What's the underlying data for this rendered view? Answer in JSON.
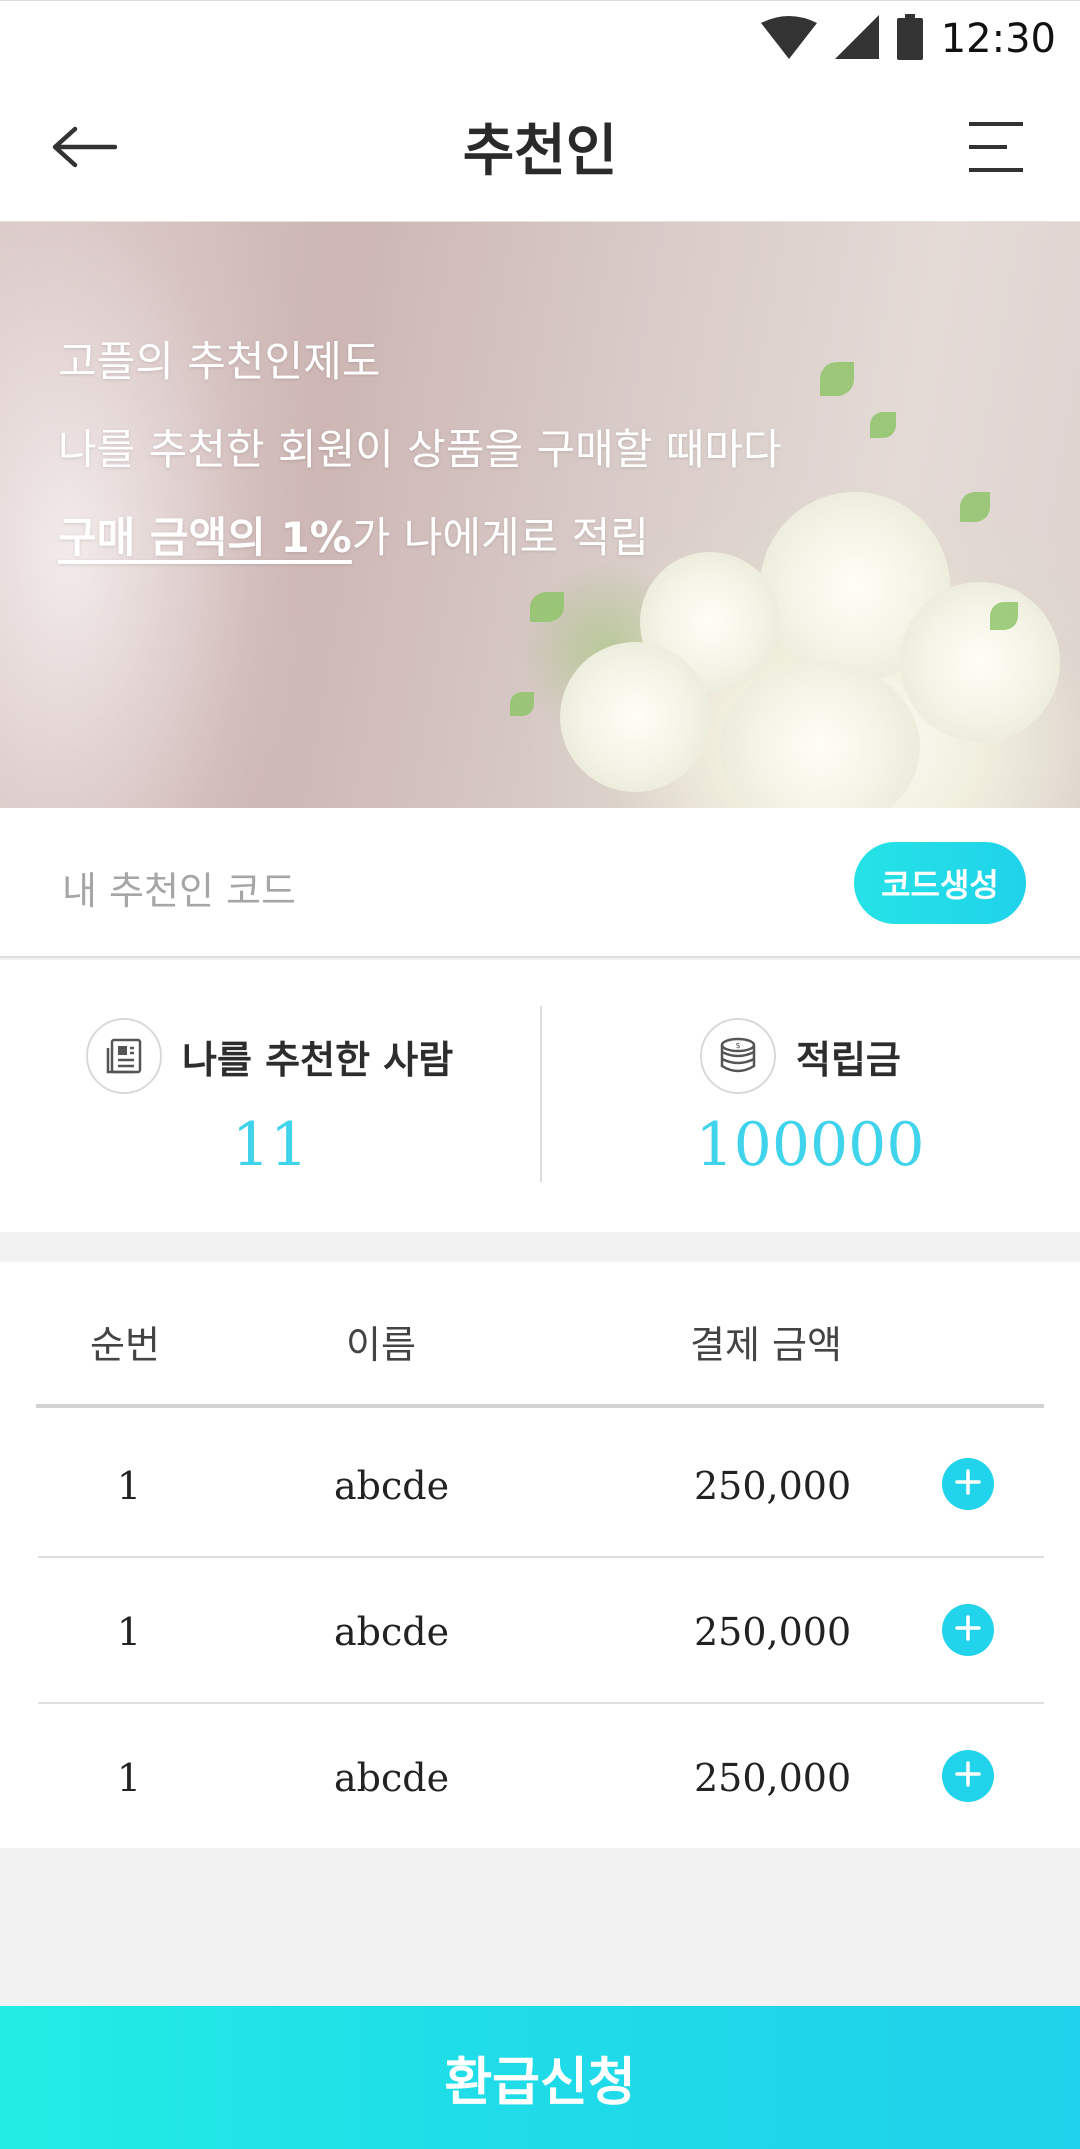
{
  "status_bar": {
    "time": "12:30"
  },
  "header": {
    "title": "추천인"
  },
  "hero": {
    "line1": "고플의 추천인제도",
    "line2": "나를 추천한 회원이 상품을 구매할 때마다",
    "line3_highlight": "구매 금액의 1%",
    "line3_rest": "가 나에게로 적립"
  },
  "referral_code": {
    "label": "내 추천인 코드",
    "button_label": "코드생성"
  },
  "stats": {
    "referrers": {
      "title": "나를 추천한 사람",
      "value": "11"
    },
    "points": {
      "title": "적립금",
      "value": "100000"
    }
  },
  "table": {
    "headers": [
      "순번",
      "이름",
      "결제 금액"
    ],
    "rows": [
      {
        "no": "1",
        "name": "abcde",
        "amount": "250,000"
      },
      {
        "no": "1",
        "name": "abcde",
        "amount": "250,000"
      },
      {
        "no": "1",
        "name": "abcde",
        "amount": "250,000"
      }
    ]
  },
  "footer": {
    "refund_button": "환급신청"
  },
  "colors": {
    "accent": "#22d3ec",
    "accent_light": "#26e3e6",
    "value_text": "#3fd3ec"
  }
}
